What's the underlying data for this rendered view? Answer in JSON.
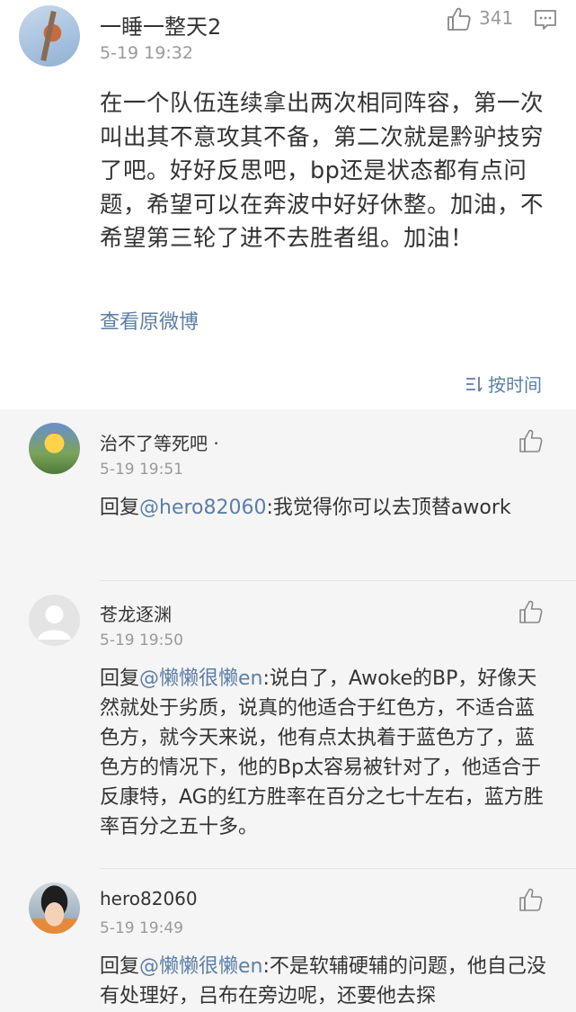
{
  "post": {
    "username": "一睡一整天2",
    "time": "5-19 19:32",
    "like_count": "341",
    "content": "在一个队伍连续拿出两次相同阵容，第一次叫出其不意攻其不备，第二次就是黔驴技穷了吧。好好反思吧，bp还是状态都有点问题，希望可以在奔波中好好休整。加油，不希望第三轮了进不去胜者组。加油！",
    "view_original": "查看原微博"
  },
  "sort": {
    "label": "按时间"
  },
  "replies": [
    {
      "username": "治不了等死吧 ·",
      "time": "5-19 19:51",
      "prefix": "回复",
      "mention": "@hero82060",
      "text": ":我觉得你可以去顶替awork"
    },
    {
      "username": "苍龙逐渊",
      "time": "5-19 19:50",
      "prefix": "回复",
      "mention": "@懒懒很懒en",
      "text": ":说白了，Awoke的BP，好像天然就处于劣质，说真的他适合于红色方，不适合蓝色方，就今天来说，他有点太执着于蓝色方了，蓝色方的情况下，他的Bp太容易被针对了，他适合于反康特，AG的红方胜率在百分之七十左右，蓝方胜率百分之五十多。"
    },
    {
      "username": "hero82060",
      "time": "5-19 19:49",
      "prefix": "回复",
      "mention": "@懒懒很懒en",
      "text": ":不是软辅硬辅的问题，他自己没有处理好，吕布在旁边呢，还要他去探"
    }
  ],
  "colors": {
    "link": "#5b7fa6",
    "muted": "#999999",
    "reply_bg": "#f5f5f5"
  },
  "icons": {
    "like": "thumbs-up-icon",
    "comment": "comment-icon",
    "sort": "sort-icon"
  }
}
